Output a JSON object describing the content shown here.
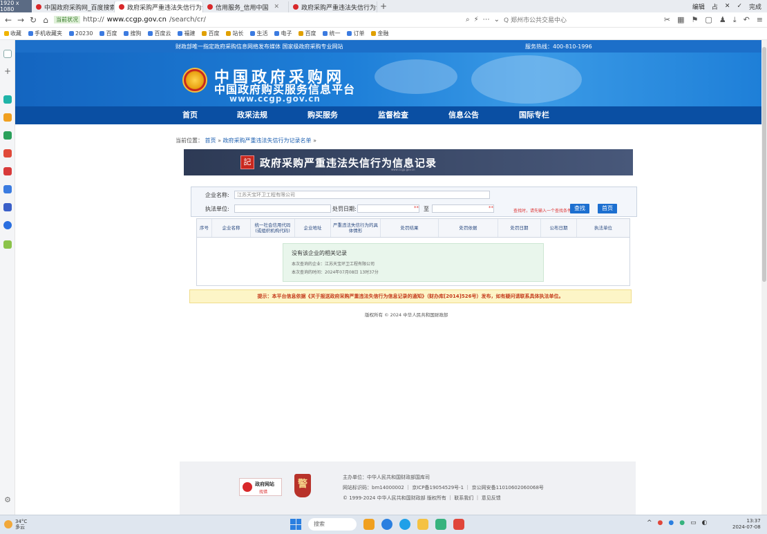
{
  "browser": {
    "resolution_badge": "1920 x 1080",
    "tabs": [
      {
        "title": "中国政府采购网_百度搜索",
        "active": false
      },
      {
        "title": "政府采购严重违法失信行为记",
        "active": true
      },
      {
        "title": "信用服务_信用中国",
        "active": false
      },
      {
        "title": "政府采购严重违法失信行为记",
        "active": false
      }
    ],
    "new_tab": "+",
    "window_controls": [
      "编辑",
      "占",
      "✕",
      "✓",
      "完成"
    ],
    "address": {
      "security_tag": "当前状况",
      "url_prefix": "http://",
      "url_host": "www.ccgp.gov.cn",
      "url_path": "/search/cr/",
      "search_placeholder": "Q 郑州市公共交易中心"
    },
    "bookmarks": [
      "收藏",
      "手机收藏夹",
      "20230",
      "百度",
      "搜狗",
      "百度云",
      "福建",
      "百度",
      "站长",
      "生活",
      "电子",
      "百度",
      "统一",
      "订单",
      "金融"
    ]
  },
  "site": {
    "topstrip_left": "财政部唯一指定政府采购信息网络发布媒体 国家级政府采购专业网站",
    "topstrip_right": "服务热线：400-810-1996",
    "title": "中国政府采购网",
    "subtitle": "中国政府购买服务信息平台",
    "url": "www.ccgp.gov.cn",
    "nav": [
      "首页",
      "政采法规",
      "购买服务",
      "监督检查",
      "信息公告",
      "国际专栏"
    ],
    "breadcrumb": {
      "prefix": "当前位置：",
      "home": "首页",
      "sep": "»",
      "current": "政府采购严重违法失信行为记录名单",
      "end": "»"
    },
    "section_title": "政府采购严重违法失信行为信息记录",
    "section_icon": "記"
  },
  "search_form": {
    "company_label": "企业名称:",
    "company_value": "江苏天宝环卫工程有限公司",
    "agency_label": "执法单位:",
    "date_label": "处罚日期:",
    "date_to": "至",
    "required_mark": "**",
    "hint": "查找时，请先输入一个查找条件",
    "search_button": "查找",
    "home_button": "首页"
  },
  "table": {
    "headers": [
      "序号",
      "企业名称",
      "统一社会信用代码 (或组织机构代码)",
      "企业地址",
      "严重违法失信行为的具体情形",
      "处罚结果",
      "处罚依据",
      "处罚日期",
      "公布日期",
      "执法单位"
    ]
  },
  "no_result": {
    "title": "没有该企业的相关记录",
    "line1": "本次查询的企业：江苏天宝环卫工程有限公司",
    "line2": "本次查询的时间：2024年07月08日 13时37分"
  },
  "notice": "提示：本平台信息依据《关于报送政府采购严重违法失信行为信息记录的通知》（财办库[2014]526号）发布，如有疑问请联系具体执法单位。",
  "copyright": "版权所有 © 2024 中华人民共和国财政部",
  "footer": {
    "gov_badge_title": "政府网站",
    "gov_badge_sub": "找错",
    "police_badge": "警",
    "host": "主办单位：中华人民共和国财政部国库司",
    "ids": "网站标识码：bm14000002 ｜ 京ICP备19054529号-1 ｜ 京公网安备11010602060068号",
    "rights": "© 1999-2024 中华人民共和国财政部 版权所有 ｜ 联系我们 ｜ 意见反馈"
  },
  "taskbar": {
    "temp": "34°C",
    "weather": "多云",
    "search": "搜索",
    "time": "13:37",
    "date": "2024-07-08"
  }
}
